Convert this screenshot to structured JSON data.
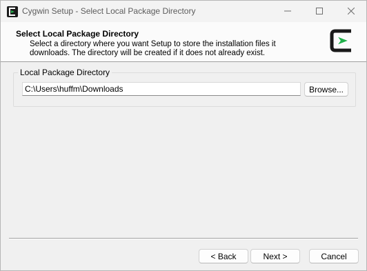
{
  "window": {
    "title": "Cygwin Setup - Select Local Package Directory",
    "icon": "cygwin-logo-icon",
    "controls": {
      "minimize_icon": "minimize-icon",
      "maximize_icon": "maximize-icon",
      "close_icon": "close-icon"
    }
  },
  "header": {
    "title": "Select Local Package Directory",
    "description": "Select a directory where you want Setup to store the installation files it\ndownloads.  The directory will be created if it does not already exist.",
    "logo": "cygwin-logo-icon"
  },
  "local_package_group": {
    "label": "Local Package Directory",
    "path_value": "C:\\Users\\huffm\\Downloads",
    "browse_label": "Browse..."
  },
  "footer": {
    "back_label": "< Back",
    "next_label": "Next >",
    "cancel_label": "Cancel"
  },
  "colors": {
    "accent_green": "#22b14c",
    "logo_black": "#1a1a1a",
    "background": "#f0f0f0"
  }
}
